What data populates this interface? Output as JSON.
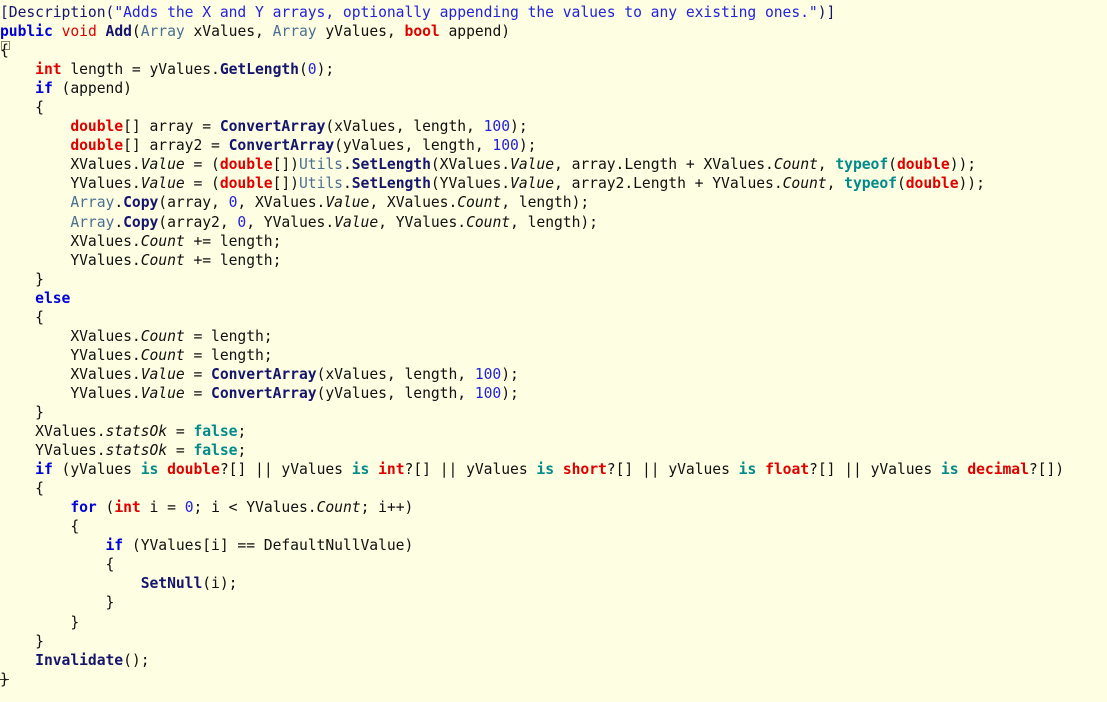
{
  "editor": {
    "background_color": "#fefee2",
    "language": "csharp",
    "font_size_px": 14.7,
    "line_height_px": 19.05
  },
  "colors": {
    "keyword": "#0000d8",
    "type": "#e00000",
    "class": "#4a6f92",
    "function": "#15156e",
    "string": "#2222dd",
    "number": "#2222dd",
    "operator_word": "#008b8b",
    "plain": "#101010",
    "property_italic": "#101010",
    "background": "#fefee2"
  },
  "gutter": {
    "fold_open_marker": "fold-box-open",
    "fold_end_marker": "fold-end-dash"
  },
  "code": {
    "line_count": 37,
    "lines": [
      "[Description(\"Adds the X and Y arrays, optionally appending the values to any existing ones.\")]",
      "public void Add(Array xValues, Array yValues, bool append)",
      "{",
      "    int length = yValues.GetLength(0);",
      "    if (append)",
      "    {",
      "        double[] array = ConvertArray(xValues, length, 100);",
      "        double[] array2 = ConvertArray(yValues, length, 100);",
      "        XValues.Value = (double[])Utils.SetLength(XValues.Value, array.Length + XValues.Count, typeof(double));",
      "        YValues.Value = (double[])Utils.SetLength(YValues.Value, array2.Length + YValues.Count, typeof(double));",
      "        Array.Copy(array, 0, XValues.Value, XValues.Count, length);",
      "        Array.Copy(array2, 0, YValues.Value, YValues.Count, length);",
      "        XValues.Count += length;",
      "        YValues.Count += length;",
      "    }",
      "    else",
      "    {",
      "        XValues.Count = length;",
      "        YValues.Count = length;",
      "        XValues.Value = ConvertArray(xValues, length, 100);",
      "        YValues.Value = ConvertArray(yValues, length, 100);",
      "    }",
      "    XValues.statsOk = false;",
      "    YValues.statsOk = false;",
      "    if (yValues is double?[] || yValues is int?[] || yValues is short?[] || yValues is float?[] || yValues is decimal?[])",
      "    {",
      "        for (int i = 0; i < YValues.Count; i++)",
      "        {",
      "            if (YValues[i] == DefaultNullValue)",
      "            {",
      "                SetNull(i);",
      "            }",
      "        }",
      "    }",
      "    Invalidate();",
      "}"
    ],
    "identifiers": {
      "method_name": "Add",
      "parameters": [
        "xValues",
        "yValues",
        "append"
      ],
      "called_methods": [
        "GetLength",
        "ConvertArray",
        "SetLength",
        "Copy",
        "SetNull",
        "Invalidate"
      ],
      "fields": [
        "XValues",
        "YValues",
        "DefaultNullValue",
        "length",
        "array",
        "array2",
        "i"
      ],
      "properties": [
        "Value",
        "Count",
        "statsOk",
        "Length"
      ],
      "types": [
        "Array",
        "double",
        "int",
        "bool",
        "short",
        "float",
        "decimal",
        "void"
      ],
      "classes": [
        "Utils",
        "Array"
      ],
      "attribute": "Description",
      "doc_string": "Adds the X and Y arrays, optionally appending the values to any existing ones.",
      "literals": [
        "100",
        "0",
        "false"
      ]
    }
  }
}
